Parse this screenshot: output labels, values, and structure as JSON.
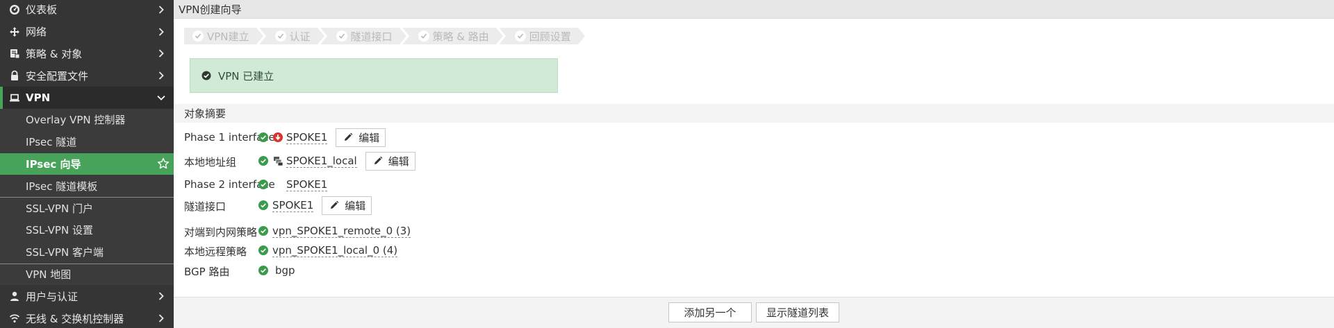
{
  "sidebar": {
    "items": [
      {
        "label": "仪表板",
        "icon": "dashboard-icon"
      },
      {
        "label": "网络",
        "icon": "network-arrows-icon"
      },
      {
        "label": "策略 & 对象",
        "icon": "policy-icon"
      },
      {
        "label": "安全配置文件",
        "icon": "lock-icon"
      },
      {
        "label": "VPN",
        "icon": "laptop-icon"
      },
      {
        "label": "用户与认证",
        "icon": "user-icon"
      },
      {
        "label": "无线 & 交换机控制器",
        "icon": "wifi-icon"
      }
    ],
    "vpn_sub": [
      {
        "label": "Overlay VPN 控制器"
      },
      {
        "label": "IPsec 隧道"
      },
      {
        "label": "IPsec 向导"
      },
      {
        "label": "IPsec 隧道模板"
      },
      {
        "label": "SSL-VPN 门户"
      },
      {
        "label": "SSL-VPN 设置"
      },
      {
        "label": "SSL-VPN 客户端"
      },
      {
        "label": "VPN 地图"
      }
    ]
  },
  "header": {
    "title": "VPN创建向导"
  },
  "steps": [
    "VPN建立",
    "认证",
    "隧道接口",
    "策略 & 路由",
    "回顾设置"
  ],
  "banner": {
    "text": "VPN 已建立"
  },
  "summary": {
    "title": "对象摘要",
    "edit_label": "编辑",
    "rows": [
      {
        "label": "Phase 1 interface",
        "value": "SPOKE1"
      },
      {
        "label": "本地地址组",
        "value": "SPOKE1_local"
      },
      {
        "label": "Phase 2 interface",
        "value": "SPOKE1"
      },
      {
        "label": "隧道接口",
        "value": "SPOKE1"
      },
      {
        "label": "对端到内网策略",
        "value": "vpn_SPOKE1_remote_0 (3)"
      },
      {
        "label": "本地远程策略",
        "value": "vpn_SPOKE1_local_0 (4)"
      },
      {
        "label": "BGP 路由",
        "value": "bgp"
      }
    ]
  },
  "footer": {
    "add_another": "添加另一个",
    "show_tunnels": "显示隧道列表"
  },
  "colors": {
    "sidebar_bg": "#353535",
    "active_green": "#48a35a",
    "ok_green": "#3c9a4c",
    "banner_bg": "#d1ead6",
    "down_red": "#d9342b"
  }
}
